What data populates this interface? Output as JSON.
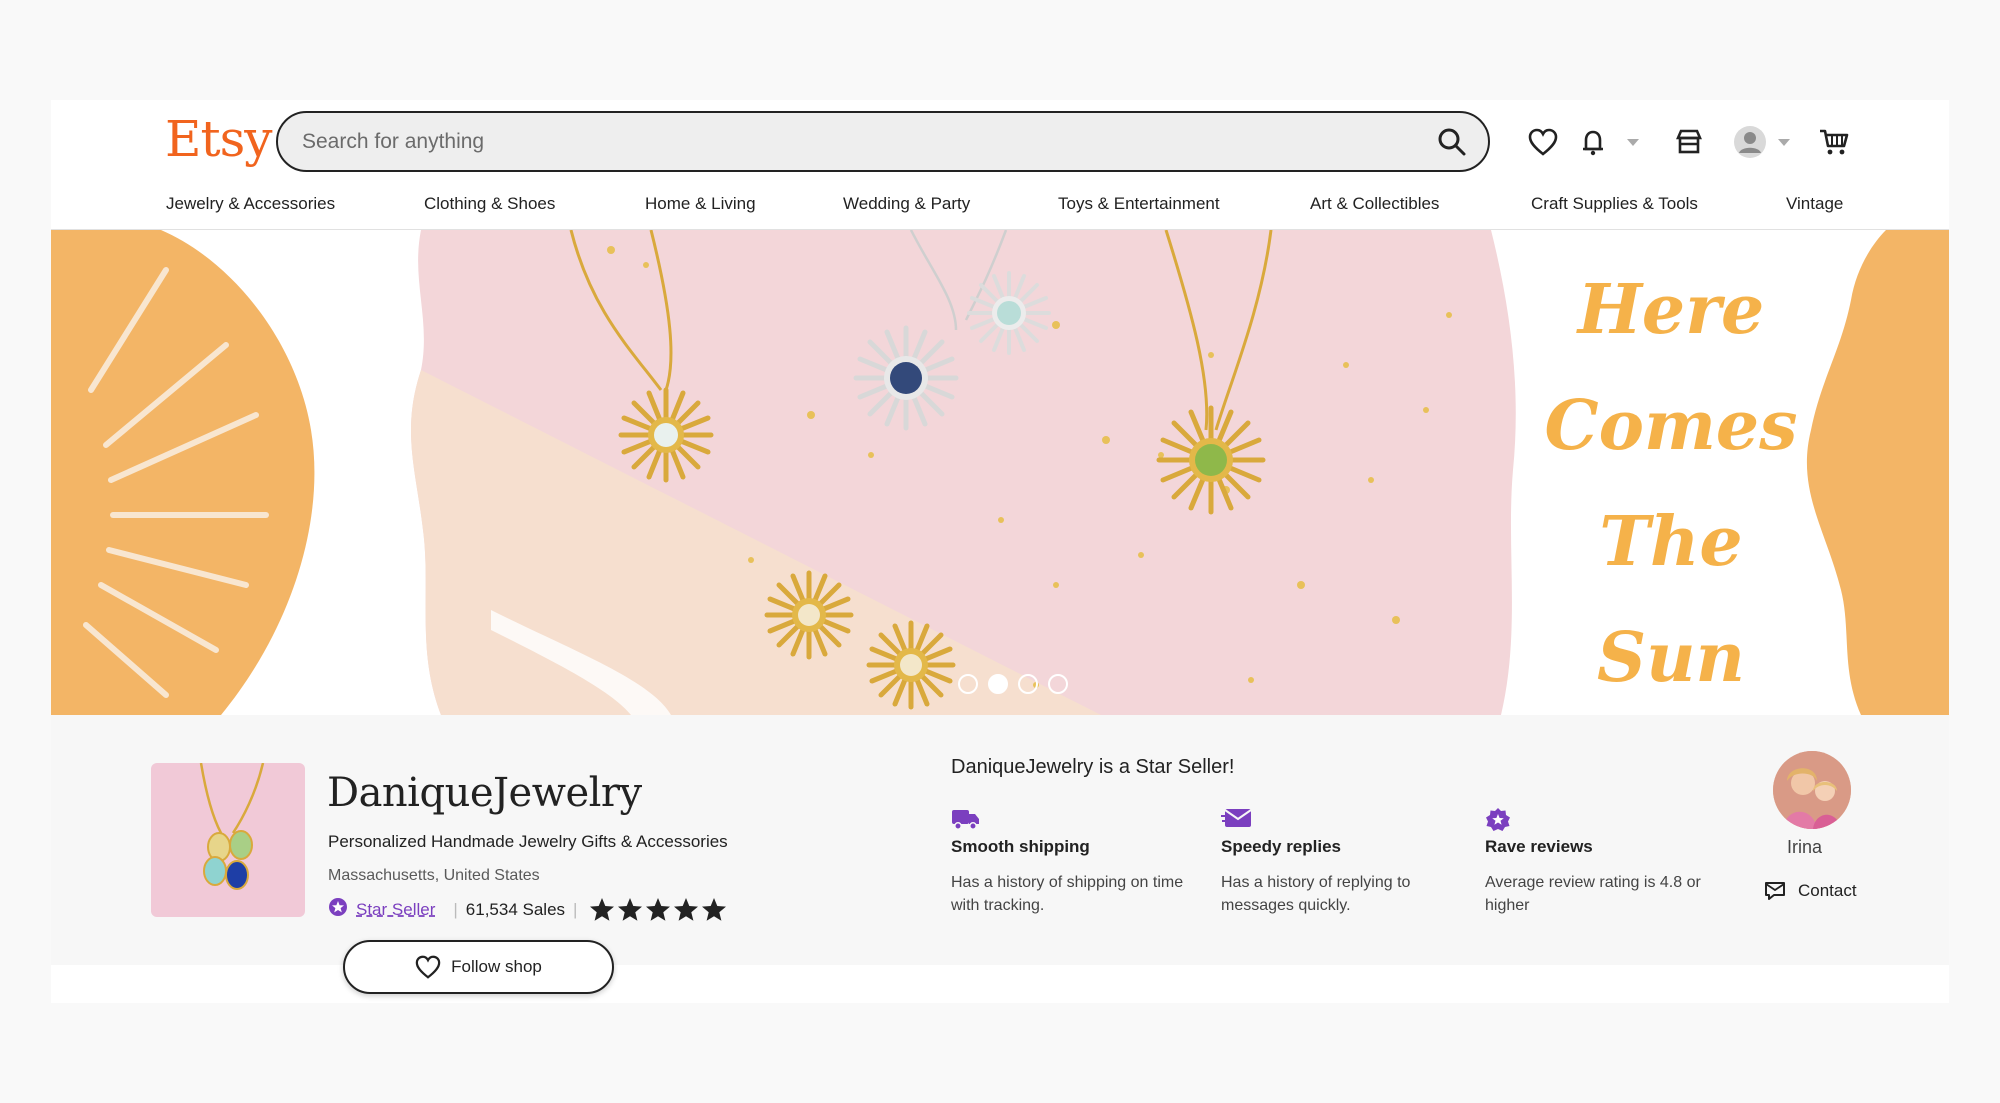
{
  "header": {
    "logo": "Etsy",
    "search_placeholder": "Search for anything"
  },
  "nav": [
    "Jewelry & Accessories",
    "Clothing & Shoes",
    "Home & Living",
    "Wedding & Party",
    "Toys & Entertainment",
    "Art & Collectibles",
    "Craft Supplies & Tools",
    "Vintage"
  ],
  "banner": {
    "tagline_lines": [
      "Here",
      "Comes",
      "The",
      "Sun"
    ],
    "carousel": {
      "count": 4,
      "active": 2
    }
  },
  "shop": {
    "name": "DaniqueJewelry",
    "tagline": "Personalized Handmade Jewelry Gifts & Accessories",
    "location": "Massachusetts, United States",
    "star_seller_label": "Star Seller",
    "sales": "61,534 Sales",
    "rating_stars": 5,
    "follow_label": "Follow shop"
  },
  "star_seller": {
    "title": "DaniqueJewelry is a Star Seller!",
    "features": [
      {
        "icon": "truck-icon",
        "title": "Smooth shipping",
        "desc": "Has a history of shipping on time with tracking."
      },
      {
        "icon": "message-icon",
        "title": "Speedy replies",
        "desc": "Has a history of replying to messages quickly."
      },
      {
        "icon": "star-badge-icon",
        "title": "Rave reviews",
        "desc": "Average review rating is 4.8 or higher"
      }
    ]
  },
  "owner": {
    "name": "Irina",
    "contact_label": "Contact"
  },
  "colors": {
    "brand": "#f1641e",
    "star_seller": "#7b3fbf",
    "banner_orange": "#f3b566",
    "banner_script": "#f5b24a"
  }
}
